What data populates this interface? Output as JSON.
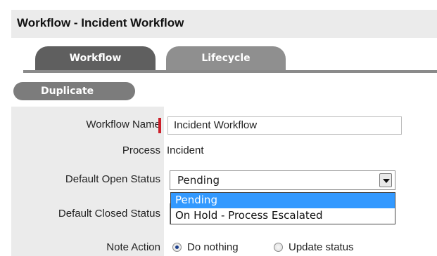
{
  "page": {
    "title": "Workflow - Incident Workflow"
  },
  "tabs": [
    {
      "label": "Workflow",
      "active": true
    },
    {
      "label": "Lifecycle",
      "active": false
    }
  ],
  "actions": {
    "duplicate_label": "Duplicate"
  },
  "form": {
    "workflow_name": {
      "label": "Workflow Name",
      "value": "Incident Workflow",
      "required": true
    },
    "process": {
      "label": "Process",
      "value": "Incident"
    },
    "default_open_status": {
      "label": "Default Open Status",
      "value": "Pending",
      "options": [
        "Pending",
        "On Hold - Process Escalated"
      ]
    },
    "default_closed_status": {
      "label": "Default Closed Status"
    },
    "note_action": {
      "label": "Note Action",
      "options": [
        "Do nothing",
        "Update status"
      ],
      "selected": "Do nothing"
    }
  },
  "colors": {
    "required_marker": "#cc1f2a",
    "dropdown_highlight": "#3399ff",
    "tab_active": "#5f5f5f",
    "tab_inactive": "#8f8f8f"
  }
}
